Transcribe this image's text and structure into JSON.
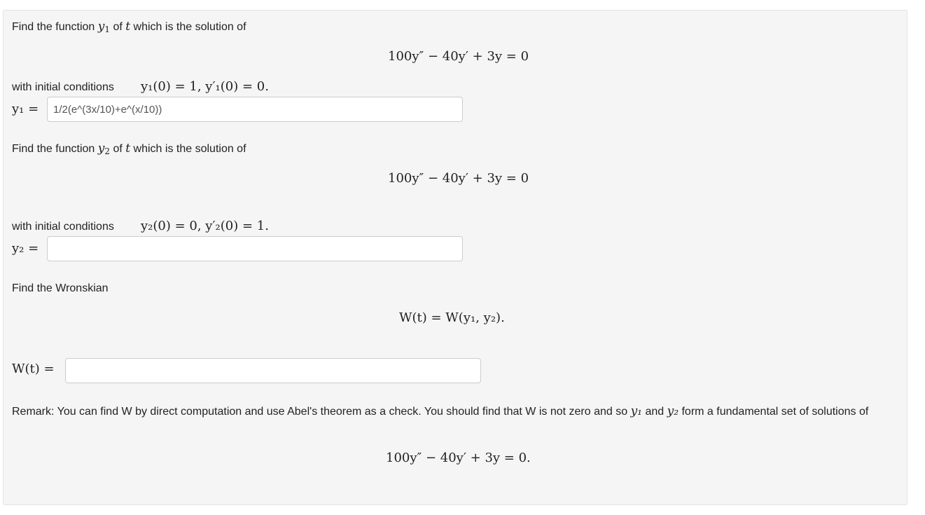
{
  "part1": {
    "intro_before": "Find the function",
    "intro_func": "y",
    "intro_sub": "1",
    "intro_mid": "of",
    "intro_var": "t",
    "intro_after": "which is the solution of",
    "equation": "100y″ − 40y′ + 3y = 0",
    "ic_label": "with initial conditions",
    "ic_math": "y₁(0) = 1,   y′₁(0) = 0.",
    "answer_label": "y₁ =",
    "answer_value": "1/2(e^(3x/10)+e^(x/10))"
  },
  "part2": {
    "intro_before": "Find the function",
    "intro_func": "y",
    "intro_sub": "2",
    "intro_mid": "of",
    "intro_var": "t",
    "intro_after": "which is the solution of",
    "equation": "100y″ − 40y′ + 3y = 0",
    "ic_label": "with initial conditions",
    "ic_math": "y₂(0) = 0,   y′₂(0) = 1.",
    "answer_label": "y₂ =",
    "answer_value": ""
  },
  "part3": {
    "intro": "Find the Wronskian",
    "equation": "W(t) = W(y₁, y₂).",
    "answer_label": "W(t) =",
    "answer_value": ""
  },
  "remark": {
    "text_a": "Remark: You can find W by direct computation and use Abel's theorem as a check. You should find that W is not zero and so",
    "y1": "y₁",
    "and": "and",
    "y2": "y₂",
    "text_b": "form a fundamental set of solutions of",
    "equation": "100y″ − 40y′ + 3y = 0."
  }
}
